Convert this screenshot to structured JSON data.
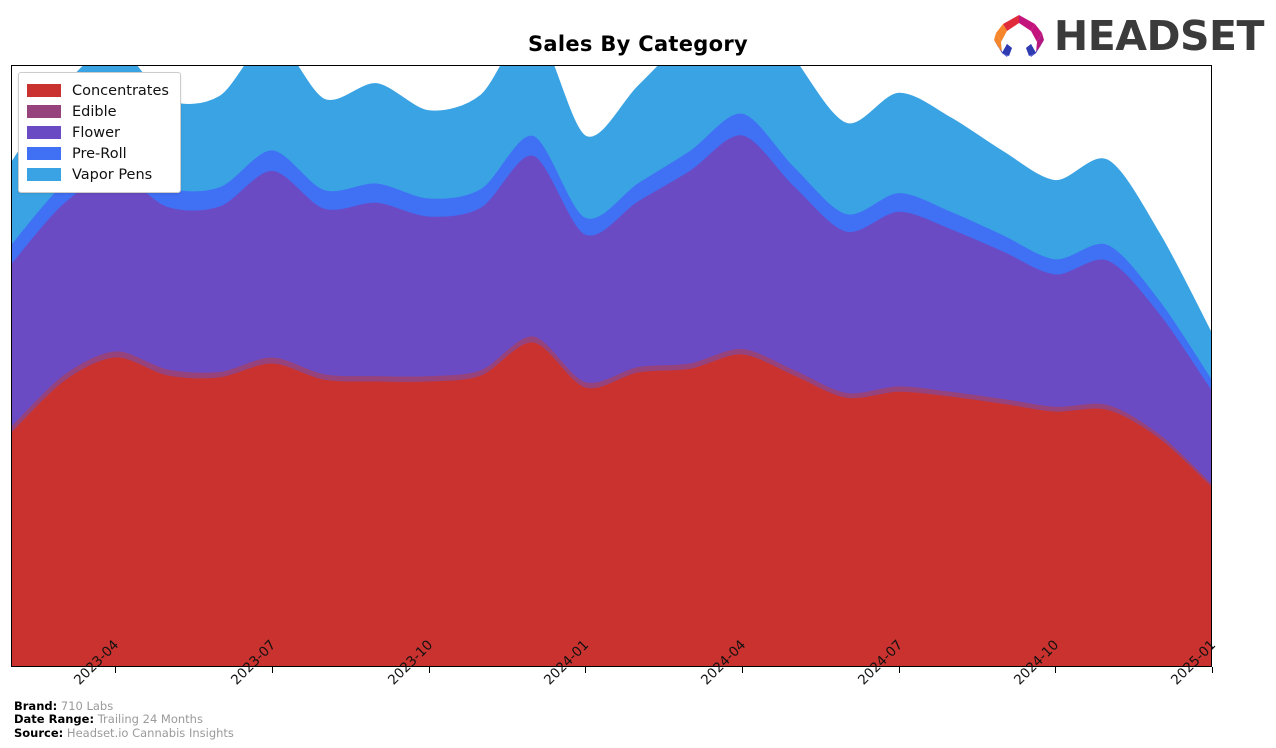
{
  "header": {
    "title": "Sales By Category",
    "logo_word": "HEADSET",
    "logo_mark_name": "headset-hexagon-logo"
  },
  "legend": {
    "position": "top-left",
    "items": [
      {
        "label": "Concentrates",
        "color": "#C9322F"
      },
      {
        "label": "Edible",
        "color": "#96437D"
      },
      {
        "label": "Flower",
        "color": "#6A4BC4"
      },
      {
        "label": "Pre-Roll",
        "color": "#4070F4"
      },
      {
        "label": "Vapor Pens",
        "color": "#3AA3E3"
      }
    ]
  },
  "footer": {
    "rows": [
      {
        "key": "Brand:",
        "value": "710 Labs"
      },
      {
        "key": "Date Range:",
        "value": "Trailing 24 Months"
      },
      {
        "key": "Source:",
        "value": "Headset.io Cannabis Insights"
      }
    ]
  },
  "chart_data": {
    "type": "area",
    "stacked": true,
    "smoothing": "spline",
    "title": "Sales By Category",
    "xlabel": "",
    "ylabel": "",
    "grid": false,
    "legend_position": "top-left",
    "axis": {
      "x_tick_labels": [
        "2023-04",
        "2023-07",
        "2023-10",
        "2024-01",
        "2024-04",
        "2024-07",
        "2024-10",
        "2025-01"
      ],
      "x_tick_months": [
        "2023-04",
        "2023-07",
        "2023-10",
        "2024-01",
        "2024-04",
        "2024-07",
        "2024-10",
        "2025-01"
      ],
      "x_tick_rotation_deg": -45,
      "y_axis_visible": false,
      "ylim": [
        0,
        100
      ]
    },
    "x": [
      "2023-02",
      "2023-03",
      "2023-04",
      "2023-05",
      "2023-06",
      "2023-07",
      "2023-08",
      "2023-09",
      "2023-10",
      "2023-11",
      "2023-12",
      "2024-01",
      "2024-02",
      "2024-03",
      "2024-04",
      "2024-05",
      "2024-06",
      "2024-07",
      "2024-08",
      "2024-09",
      "2024-10",
      "2024-11",
      "2024-12",
      "2025-01"
    ],
    "series": [
      {
        "name": "Concentrates",
        "color": "#C9322F",
        "values": [
          39.0,
          47.5,
          51.5,
          48.5,
          48.2,
          50.5,
          47.8,
          47.5,
          47.5,
          48.5,
          54.0,
          46.5,
          49.0,
          49.6,
          52.0,
          48.5,
          44.8,
          45.8,
          45.0,
          43.8,
          42.5,
          42.8,
          38.0,
          30.0
        ]
      },
      {
        "name": "Edible",
        "color": "#96437D",
        "values": [
          1.0,
          1.0,
          1.0,
          1.0,
          0.9,
          1.0,
          0.9,
          0.9,
          0.9,
          0.9,
          1.0,
          0.9,
          0.9,
          0.9,
          0.9,
          0.9,
          0.8,
          0.9,
          0.8,
          0.8,
          0.8,
          0.8,
          0.7,
          0.5
        ]
      },
      {
        "name": "Flower",
        "color": "#6A4BC4",
        "values": [
          27.0,
          28.5,
          29.5,
          27.0,
          27.5,
          31.0,
          27.5,
          28.8,
          26.5,
          27.0,
          30.0,
          24.5,
          27.5,
          32.0,
          35.5,
          30.5,
          26.8,
          29.0,
          27.0,
          24.5,
          22.0,
          24.0,
          20.0,
          15.5
        ]
      },
      {
        "name": "Pre-Roll",
        "color": "#4070F4",
        "values": [
          3.2,
          3.3,
          3.4,
          3.2,
          3.2,
          3.4,
          3.1,
          3.2,
          3.0,
          3.1,
          3.3,
          2.8,
          3.0,
          3.3,
          3.6,
          3.2,
          2.9,
          3.1,
          2.9,
          2.7,
          2.5,
          2.6,
          2.2,
          1.8
        ]
      },
      {
        "name": "Vapor Pens",
        "color": "#3AA3E3",
        "values": [
          13.5,
          16.0,
          17.5,
          14.5,
          15.0,
          18.5,
          15.0,
          16.5,
          14.5,
          15.5,
          18.0,
          13.5,
          16.0,
          19.5,
          22.5,
          18.0,
          15.0,
          16.5,
          15.5,
          13.8,
          13.0,
          14.0,
          11.0,
          7.5
        ]
      }
    ]
  }
}
